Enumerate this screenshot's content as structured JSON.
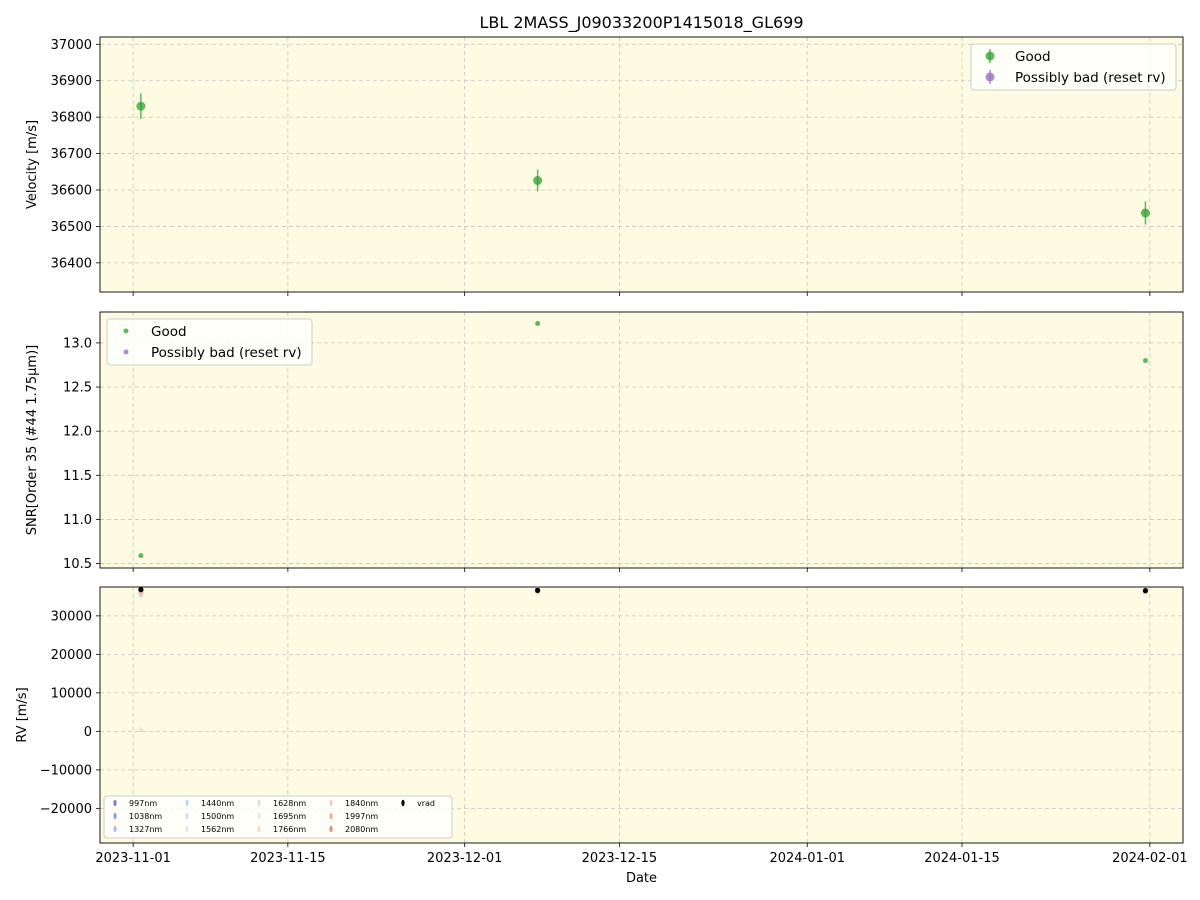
{
  "chart_data": [
    {
      "type": "scatter",
      "title": "LBL 2MASS_J09033200P1415018_GL699",
      "ylabel": "Velocity [m/s]",
      "xlabel": "",
      "xlim": [
        "2023-10-29",
        "2024-02-04"
      ],
      "ylim": [
        36320,
        37020
      ],
      "xticks": [
        "2023-11-01",
        "2023-11-15",
        "2023-12-01",
        "2023-12-15",
        "2024-01-01",
        "2024-01-15",
        "2024-02-01"
      ],
      "yticks": [
        36400,
        36500,
        36600,
        36700,
        36800,
        36900,
        37000
      ],
      "grid": true,
      "legend_position": "upper right",
      "series": [
        {
          "name": "Good",
          "color": "#2ca02c",
          "x": [
            "2023-11-01.7",
            "2023-12-07.6",
            "2024-01-31.6"
          ],
          "y": [
            36830,
            36626,
            36537
          ],
          "yerr": [
            35,
            30,
            32
          ]
        },
        {
          "name": "Possibly bad (reset rv)",
          "color": "#9467bd",
          "x": [],
          "y": [],
          "yerr": []
        }
      ]
    },
    {
      "type": "scatter",
      "title": "",
      "ylabel": "SNR[Order 35 (#44 1.75μm)]",
      "xlabel": "",
      "xlim": [
        "2023-10-29",
        "2024-02-04"
      ],
      "ylim": [
        10.45,
        13.35
      ],
      "xticks": [
        "2023-11-01",
        "2023-11-15",
        "2023-12-01",
        "2023-12-15",
        "2024-01-01",
        "2024-01-15",
        "2024-02-01"
      ],
      "yticks": [
        10.5,
        11.0,
        11.5,
        12.0,
        12.5,
        13.0
      ],
      "ytick_labels": [
        "10.5",
        "11.0",
        "11.5",
        "12.0",
        "12.5",
        "13.0"
      ],
      "grid": true,
      "legend_position": "upper left",
      "series": [
        {
          "name": "Good",
          "color": "#2ca02c",
          "x": [
            "2023-11-01.7",
            "2023-12-07.6",
            "2024-01-31.6"
          ],
          "y": [
            10.59,
            13.22,
            12.8
          ]
        },
        {
          "name": "Possibly bad (reset rv)",
          "color": "#9467bd",
          "x": [],
          "y": []
        }
      ]
    },
    {
      "type": "scatter",
      "title": "",
      "ylabel": "RV [m/s]",
      "xlabel": "Date",
      "xlim": [
        "2023-10-29",
        "2024-02-04"
      ],
      "ylim": [
        -29000,
        37500
      ],
      "xticks": [
        "2023-11-01",
        "2023-11-15",
        "2023-12-01",
        "2023-12-15",
        "2024-01-01",
        "2024-01-15",
        "2024-02-01"
      ],
      "yticks": [
        -20000,
        -10000,
        0,
        10000,
        20000,
        30000
      ],
      "ytick_labels": [
        "−20000",
        "−10000",
        "0",
        "10000",
        "20000",
        "30000"
      ],
      "grid": true,
      "legend_position": "lower left",
      "legend_columns": 5,
      "series": [
        {
          "name": "997nm",
          "color": "#3b4cc0",
          "x": [
            "2023-11-01.7",
            "2023-12-07.6",
            "2024-01-31.6"
          ],
          "y": [
            36400,
            36300,
            36200
          ]
        },
        {
          "name": "1038nm",
          "color": "#5470de",
          "x": [
            "2023-11-01.7",
            "2023-12-07.6",
            "2024-01-31.6"
          ],
          "y": [
            36500,
            36400,
            36300
          ]
        },
        {
          "name": "1327nm",
          "color": "#7b9ff9",
          "x": [
            "2023-11-01.7",
            "2023-12-07.6",
            "2024-01-31.6"
          ],
          "y": [
            35800,
            36200,
            36300
          ]
        },
        {
          "name": "1440nm",
          "color": "#9ebeff",
          "x": [
            "2023-11-01.7",
            "2023-12-07.6",
            "2024-01-31.6"
          ],
          "y": [
            36000,
            36300,
            36400
          ]
        },
        {
          "name": "1500nm",
          "color": "#c0d4f5",
          "x": [
            "2023-11-01.7",
            "2023-12-07.6",
            "2024-01-31.6"
          ],
          "y": [
            35500,
            36200,
            36300
          ]
        },
        {
          "name": "1562nm",
          "color": "#dddcdc",
          "x": [
            "2023-11-01.7",
            "2023-12-07.6",
            "2024-01-31.6"
          ],
          "y": [
            35300,
            36100,
            36200
          ]
        },
        {
          "name": "1628nm",
          "color": "#cfd1d6",
          "x": [
            "2023-11-01.7",
            "2023-12-07.6",
            "2024-01-31.6"
          ],
          "y": [
            36200,
            36400,
            36400
          ]
        },
        {
          "name": "1695nm",
          "color": "#e5d8d1",
          "x": [
            "2023-11-01.7",
            "2023-12-07.6",
            "2024-01-31.6"
          ],
          "y": [
            400,
            36300,
            36300
          ]
        },
        {
          "name": "1766nm",
          "color": "#f2cbb7",
          "x": [
            "2023-11-01.7",
            "2023-12-07.6",
            "2024-01-31.6"
          ],
          "y": [
            36100,
            36300,
            36300
          ]
        },
        {
          "name": "1840nm",
          "color": "#f7b89c",
          "x": [
            "2023-11-01.7",
            "2023-12-07.6",
            "2024-01-31.6"
          ],
          "y": [
            36300,
            36500,
            36400
          ]
        },
        {
          "name": "1997nm",
          "color": "#f18d6f",
          "x": [
            "2023-11-01.7",
            "2023-12-07.6",
            "2024-01-31.6"
          ],
          "y": [
            36600,
            37000,
            36600
          ]
        },
        {
          "name": "2080nm",
          "color": "#dd5f4b",
          "x": [
            "2023-11-01.7",
            "2023-12-07.6",
            "2024-01-31.6"
          ],
          "y": [
            36700,
            36800,
            36700
          ]
        },
        {
          "name": "vrad",
          "color": "#000000",
          "x": [
            "2023-11-01.7",
            "2023-12-07.6",
            "2024-01-31.6"
          ],
          "y": [
            36830,
            36626,
            36537
          ]
        }
      ]
    }
  ]
}
